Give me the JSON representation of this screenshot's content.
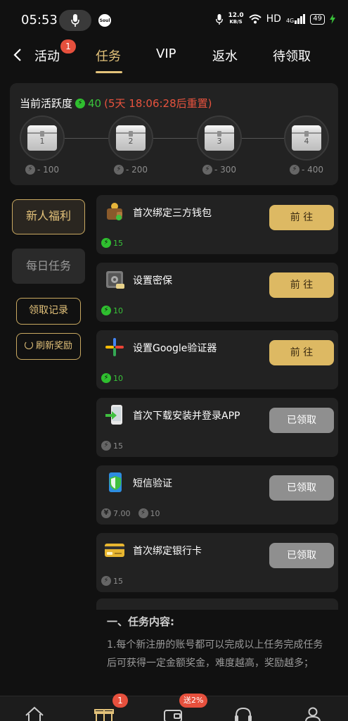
{
  "status_bar": {
    "time": "05:53",
    "speed_value": "12.0",
    "speed_unit": "KB/S",
    "network": "HD",
    "signal": "4G",
    "battery": "49",
    "app_badge": "Soul"
  },
  "nav": {
    "tabs": [
      {
        "label": "活动",
        "badge": "1"
      },
      {
        "label": "任务"
      },
      {
        "label": "VIP"
      },
      {
        "label": "返水"
      },
      {
        "label": "待领取"
      }
    ],
    "active_tab": "任务"
  },
  "activity": {
    "label": "当前活跃度",
    "value": "40",
    "reset_prefix": "(5天 18:06:28",
    "reset_suffix": "后重置)",
    "chests": [
      {
        "num": "1",
        "cost": "- 100"
      },
      {
        "num": "2",
        "cost": "- 200"
      },
      {
        "num": "3",
        "cost": "- 300"
      },
      {
        "num": "4",
        "cost": "- 400"
      }
    ]
  },
  "side_menu": {
    "newbie": "新人福利",
    "daily": "每日任务",
    "record": "领取记录",
    "refresh": "刷新奖励"
  },
  "tasks": [
    {
      "name": "首次绑定三方钱包",
      "reward": "15",
      "button": "前 往",
      "state": "go",
      "icon": "wallet-icon"
    },
    {
      "name": "设置密保",
      "reward": "10",
      "button": "前 往",
      "state": "go",
      "icon": "safe-icon"
    },
    {
      "name": "设置Google验证器",
      "reward": "10",
      "button": "前 往",
      "state": "go",
      "icon": "google-authenticator-icon"
    },
    {
      "name": "首次下载安装并登录APP",
      "reward": "15",
      "button": "已领取",
      "state": "done",
      "icon": "phone-download-icon"
    },
    {
      "name": "短信验证",
      "reward_money": "7.00",
      "reward": "10",
      "button": "已领取",
      "state": "done",
      "icon": "shield-phone-icon"
    },
    {
      "name": "首次绑定银行卡",
      "reward": "15",
      "button": "已领取",
      "state": "done",
      "icon": "bank-card-icon"
    }
  ],
  "description": {
    "title": "一、任务内容:",
    "text": "1.每个新注册的账号都可以完成以上任务完成任务后可获得一定金额奖金，难度越高，奖励越多；"
  },
  "bottom_nav": {
    "gift_badge": "1",
    "promo_badge": "送2%"
  },
  "colors": {
    "gold": "#e3c27a",
    "green": "#39c23a",
    "red": "#e8533e",
    "button_gold": "#ddb963",
    "button_grey": "#8f8f8f"
  }
}
